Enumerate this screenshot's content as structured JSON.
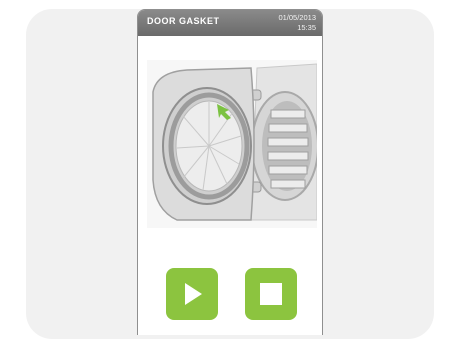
{
  "header": {
    "title": "DOOR GASKET",
    "date": "01/05/2013",
    "time": "15:35"
  },
  "illustration": {
    "icon": "autoclave-door-gasket-illustration"
  },
  "controls": {
    "play_icon": "play-icon",
    "stop_icon": "stop-icon",
    "accent_color": "#8cc43f"
  }
}
